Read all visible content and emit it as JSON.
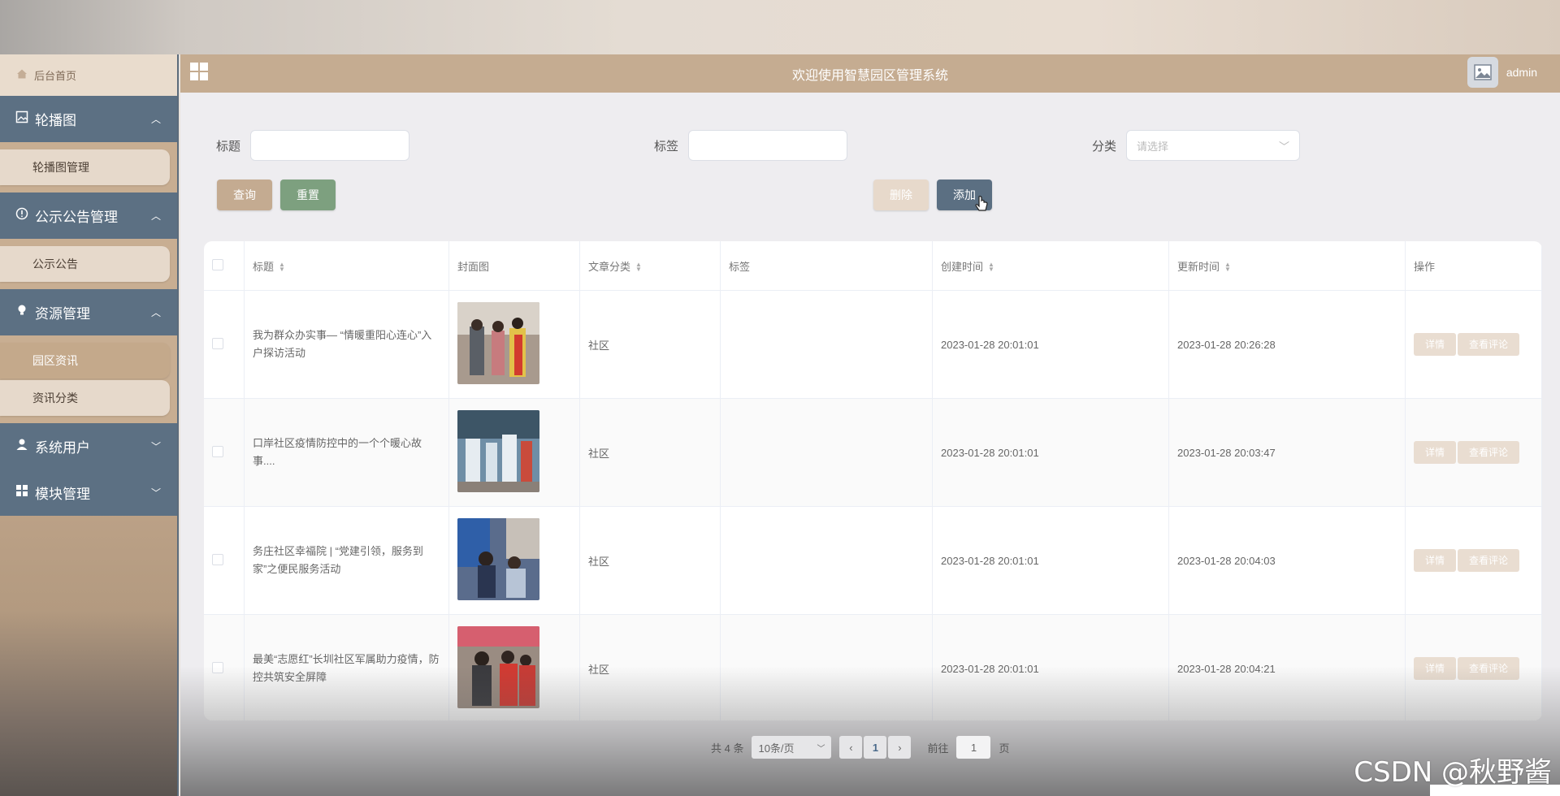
{
  "sidebar": {
    "home": "后台首页",
    "menus": [
      {
        "label": "轮播图",
        "items": [
          {
            "label": "轮播图管理"
          }
        ]
      },
      {
        "label": "公示公告管理",
        "items": [
          {
            "label": "公示公告"
          }
        ]
      },
      {
        "label": "资源管理",
        "items": [
          {
            "label": "园区资讯",
            "active": true
          },
          {
            "label": "资讯分类"
          }
        ]
      },
      {
        "label": "系统用户",
        "items": []
      },
      {
        "label": "模块管理",
        "items": []
      }
    ]
  },
  "header": {
    "title": "欢迎使用智慧园区管理系统",
    "user": "admin"
  },
  "search": {
    "title_label": "标题",
    "tag_label": "标签",
    "category_label": "分类",
    "category_placeholder": "请选择",
    "query": "查询",
    "reset": "重置",
    "delete": "删除",
    "add": "添加"
  },
  "table": {
    "headers": [
      "标题",
      "封面图",
      "文章分类",
      "标签",
      "创建时间",
      "更新时间",
      "操作"
    ],
    "rows": [
      {
        "title": "我为群众办实事— “情暖重阳心连心”入户探访活动",
        "category": "社区",
        "tag": "",
        "created": "2023-01-28 20:01:01",
        "updated": "2023-01-28 20:26:28"
      },
      {
        "title": "口岸社区疫情防控中的一个个暖心故事....",
        "category": "社区",
        "tag": "",
        "created": "2023-01-28 20:01:01",
        "updated": "2023-01-28 20:03:47"
      },
      {
        "title": "务庄社区幸福院 | “党建引领，服务到家”之便民服务活动",
        "category": "社区",
        "tag": "",
        "created": "2023-01-28 20:01:01",
        "updated": "2023-01-28 20:04:03"
      },
      {
        "title": "最美“志愿红”长圳社区军属助力疫情，防控共筑安全屏障",
        "category": "社区",
        "tag": "",
        "created": "2023-01-28 20:01:01",
        "updated": "2023-01-28 20:04:21"
      }
    ],
    "detail_label": "详情",
    "comment_label": "查看评论"
  },
  "pagination": {
    "total": "共 4 条",
    "page_size": "10条/页",
    "current": "1",
    "goto_label": "前往",
    "goto_value": "1",
    "page_unit": "页"
  },
  "watermark": "CSDN @秋野酱"
}
